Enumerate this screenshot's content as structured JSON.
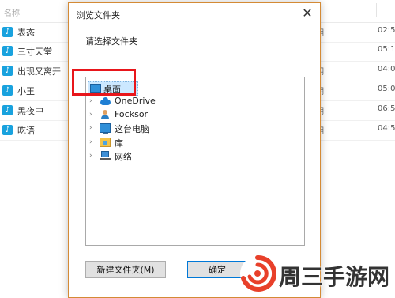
{
  "background_list": {
    "header": {
      "name_column": "名称"
    },
    "rows": [
      {
        "song": "表态",
        "album_tail": "明",
        "time": "02:5"
      },
      {
        "song": "三寸天堂",
        "album_tail": "",
        "time": "05:1"
      },
      {
        "song": "出现又离开",
        "album_tail": "明",
        "time": "04:0"
      },
      {
        "song": "小王",
        "album_tail": "明",
        "time": "05:0"
      },
      {
        "song": "黑夜中",
        "album_tail": "明",
        "time": "06:5"
      },
      {
        "song": "呓语",
        "album_tail": "明",
        "time": "04:5"
      }
    ],
    "icon": "music-note-icon"
  },
  "dialog": {
    "title": "浏览文件夹",
    "close_glyph": "✕",
    "prompt": "请选择文件夹",
    "tree": [
      {
        "label": "桌面",
        "icon": "monitor-icon",
        "selected": true
      },
      {
        "label": "OneDrive",
        "icon": "cloud-icon"
      },
      {
        "label": "Focksor",
        "icon": "user-icon"
      },
      {
        "label": "这台电脑",
        "icon": "monitor-icon"
      },
      {
        "label": "库",
        "icon": "library-icon"
      },
      {
        "label": "网络",
        "icon": "network-icon"
      }
    ],
    "chevron_glyph": "›",
    "buttons": {
      "new_folder": "新建文件夹(M)",
      "ok": "确定"
    }
  },
  "watermark": {
    "text": "周三手游网"
  },
  "colors": {
    "accent_orange_border": "#d48a35",
    "selection_blue": "#cce8ff",
    "highlight_red": "#e8161b",
    "note_icon_blue": "#19a2de"
  }
}
